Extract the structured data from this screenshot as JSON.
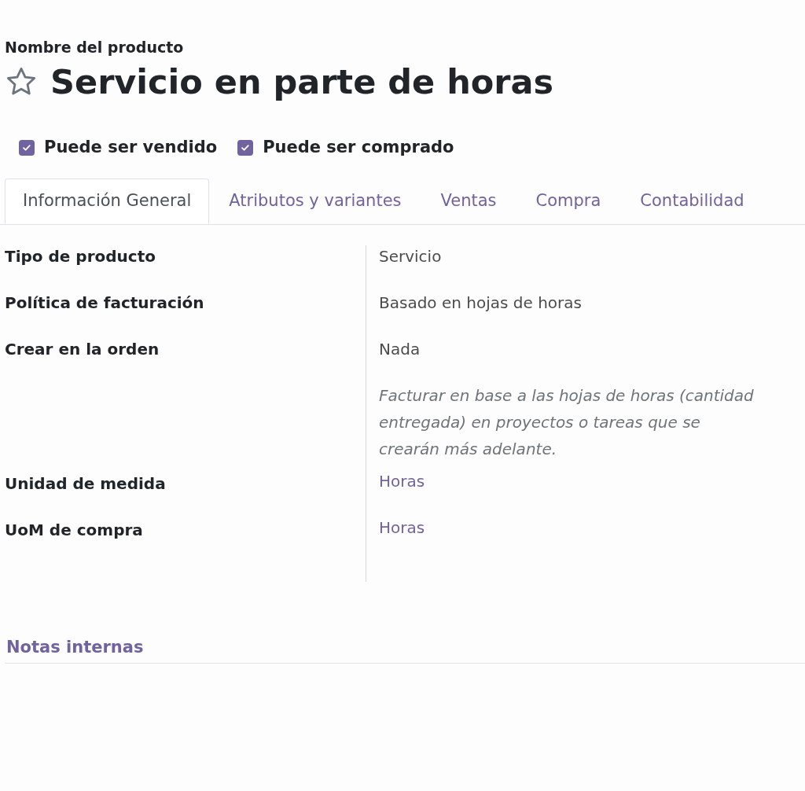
{
  "product_name_label": "Nombre del producto",
  "product": {
    "title": "Servicio en parte de horas",
    "starred": false
  },
  "options": [
    {
      "label": "Puede ser vendido",
      "checked": true
    },
    {
      "label": "Puede ser comprado",
      "checked": true
    }
  ],
  "tabs": [
    {
      "label": "Información General",
      "selected": true
    },
    {
      "label": "Atributos y variantes",
      "selected": false
    },
    {
      "label": "Ventas",
      "selected": false
    },
    {
      "label": "Compra",
      "selected": false
    },
    {
      "label": "Contabilidad",
      "selected": false
    }
  ],
  "fields": [
    {
      "label": "Tipo de producto",
      "value": "Servicio",
      "kind": "text"
    },
    {
      "label": "Política de facturación",
      "value": "Basado en hojas de horas",
      "kind": "text"
    },
    {
      "label": "Crear en la orden",
      "value": "Nada",
      "kind": "text"
    },
    {
      "value": "Facturar en base a las hojas de horas (cantidad entregada) en proyectos o tareas que se crearán más adelante.",
      "kind": "help"
    },
    {
      "label": "Unidad de medida",
      "value": "Horas",
      "kind": "link"
    },
    {
      "label": "UoM de compra",
      "value": "Horas",
      "kind": "link"
    }
  ],
  "section": {
    "title": "Notas internas"
  }
}
